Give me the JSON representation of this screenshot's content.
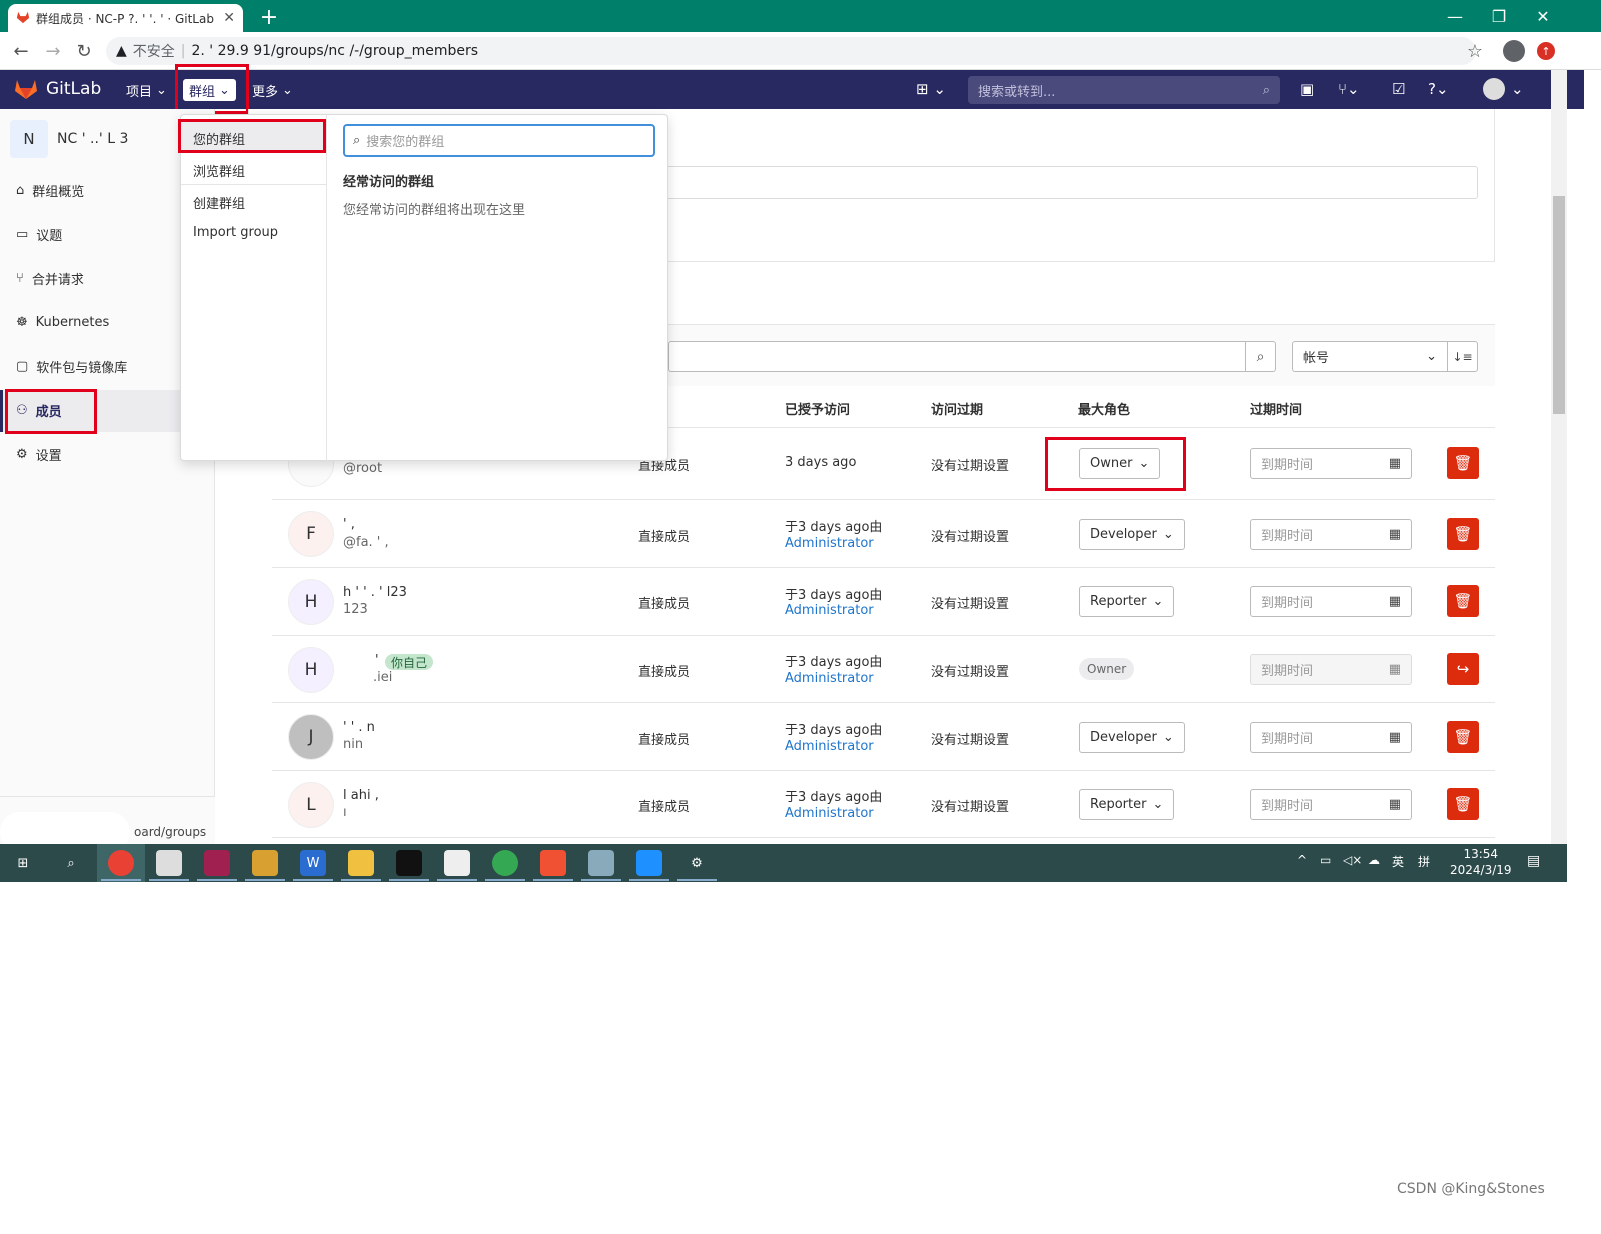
{
  "browser": {
    "tab_title": "群组成员 · NC-P  ?. ' '. ' · GitLab",
    "address_insecure_label": "不安全",
    "address_url": "2.  ' 29.9    91/groups/nc    /-/group_members"
  },
  "gitlab_nav": {
    "brand": "GitLab",
    "menu_projects": "项目",
    "menu_groups": "群组",
    "menu_more": "更多",
    "search_placeholder": "搜索或转到..."
  },
  "sidebar": {
    "group_initial": "N",
    "group_name": "NC ' ..' L 3",
    "items": [
      {
        "label": "群组概览",
        "icon": "home-icon"
      },
      {
        "label": "议题",
        "icon": "issues-icon"
      },
      {
        "label": "合并请求",
        "icon": "merge-request-icon"
      },
      {
        "label": "Kubernetes",
        "icon": "kubernetes-icon"
      },
      {
        "label": "软件包与镜像库",
        "icon": "package-icon"
      },
      {
        "label": "成员",
        "icon": "users-icon"
      },
      {
        "label": "设置",
        "icon": "gear-icon"
      }
    ],
    "footer_text": "oard/groups"
  },
  "groups_dropdown": {
    "left_items": [
      "您的群组",
      "浏览群组",
      "创建群组",
      "Import group"
    ],
    "search_placeholder": "搜索您的群组",
    "frequent_heading": "经常访问的群组",
    "frequent_empty": "您经常访问的群组将出现在这里"
  },
  "filter": {
    "sort_label": "帐号"
  },
  "table": {
    "headers": {
      "granted": "已授予访问",
      "expiry": "访问过期",
      "max_role": "最大角色",
      "expires_at": "过期时间"
    },
    "date_placeholder": "到期时间",
    "rows": [
      {
        "avatar": "",
        "name": "",
        "username": "@root",
        "source": "直接成员",
        "granted": "3 days ago",
        "granted_by": "",
        "expiry": "没有过期设置",
        "role": "Owner",
        "role_editable": true,
        "action": "delete"
      },
      {
        "avatar": "F",
        "name": "  ' ,",
        "username": "@fa. ' ,",
        "source": "直接成员",
        "granted": "于3 days ago由",
        "granted_by": "Administrator",
        "expiry": "没有过期设置",
        "role": "Developer",
        "role_editable": true,
        "action": "delete"
      },
      {
        "avatar": "H",
        "name": "h ' ' . ' l23",
        "username": "          123",
        "source": "直接成员",
        "granted": "于3 days ago由",
        "granted_by": "Administrator",
        "expiry": "没有过期设置",
        "role": "Reporter",
        "role_editable": true,
        "action": "delete"
      },
      {
        "avatar": "H",
        "name": "'",
        "username": ".iei",
        "badge": "你自己",
        "source": "直接成员",
        "granted": "于3 days ago由",
        "granted_by": "Administrator",
        "expiry": "没有过期设置",
        "role": "Owner",
        "role_editable": false,
        "action": "leave"
      },
      {
        "avatar": "J",
        "name": "' ' .     n",
        "username": "    nin",
        "source": "直接成员",
        "granted": "于3 days ago由",
        "granted_by": "Administrator",
        "expiry": "没有过期设置",
        "role": "Developer",
        "role_editable": true,
        "action": "delete"
      },
      {
        "avatar": "L",
        "name": "l    ahi  ,",
        "username": "        ı",
        "source": "直接成员",
        "granted": "于3 days ago由",
        "granted_by": "Administrator",
        "expiry": "没有过期设置",
        "role": "Reporter",
        "role_editable": true,
        "action": "delete"
      }
    ]
  },
  "taskbar": {
    "time": "13:54",
    "date": "2024/3/19",
    "ime": "英",
    "ime2": "拼"
  },
  "watermark": "CSDN @King&Stones",
  "colors": {
    "nav": "#292961",
    "tabstrip": "#00806a",
    "danger": "#dd2b0e",
    "highlight": "#e0001b",
    "link": "#1f75cb"
  }
}
